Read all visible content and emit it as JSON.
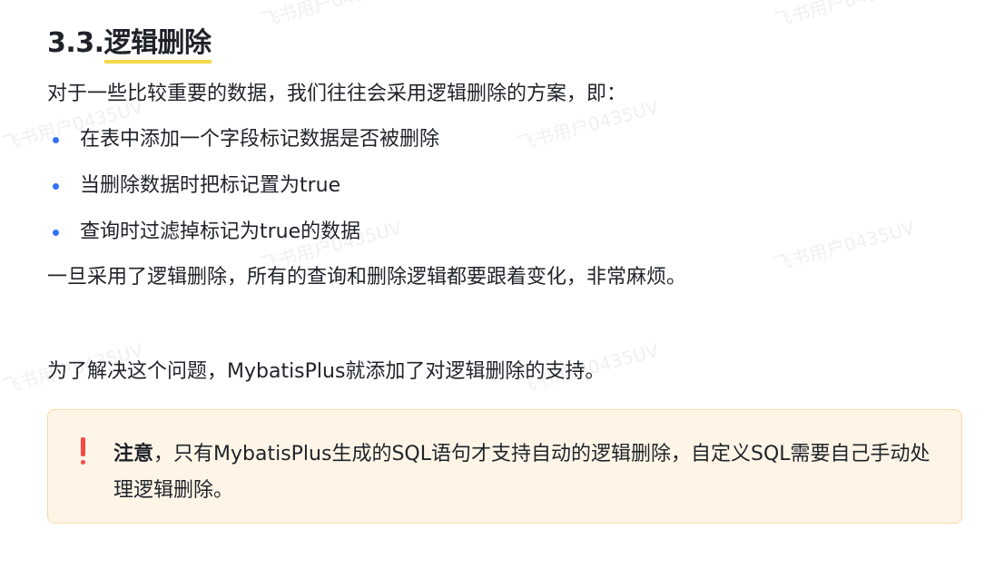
{
  "heading": {
    "number": "3.3.",
    "text": "逻辑删除"
  },
  "intro": "对于一些比较重要的数据，我们往往会采用逻辑删除的方案，即：",
  "bullets": [
    "在表中添加一个字段标记数据是否被删除",
    "当删除数据时把标记置为true",
    "查询时过滤掉标记为true的数据"
  ],
  "consequence": "一旦采用了逻辑删除，所有的查询和删除逻辑都要跟着变化，非常麻烦。",
  "solution": "为了解决这个问题，MybatisPlus就添加了对逻辑删除的支持。",
  "callout": {
    "icon": "exclamation-icon",
    "bold": "注意",
    "body": "，只有MybatisPlus生成的SQL语句才支持自动的逻辑删除，自定义SQL需要自己手动处理逻辑删除。"
  },
  "watermark": "飞书用户0435UV",
  "colors": {
    "bullet": "#3370ff",
    "heading_underline": "#f5d84a",
    "callout_bg": "#fef5e7",
    "callout_border": "#f8d9a6",
    "callout_icon": "#f54a45"
  }
}
